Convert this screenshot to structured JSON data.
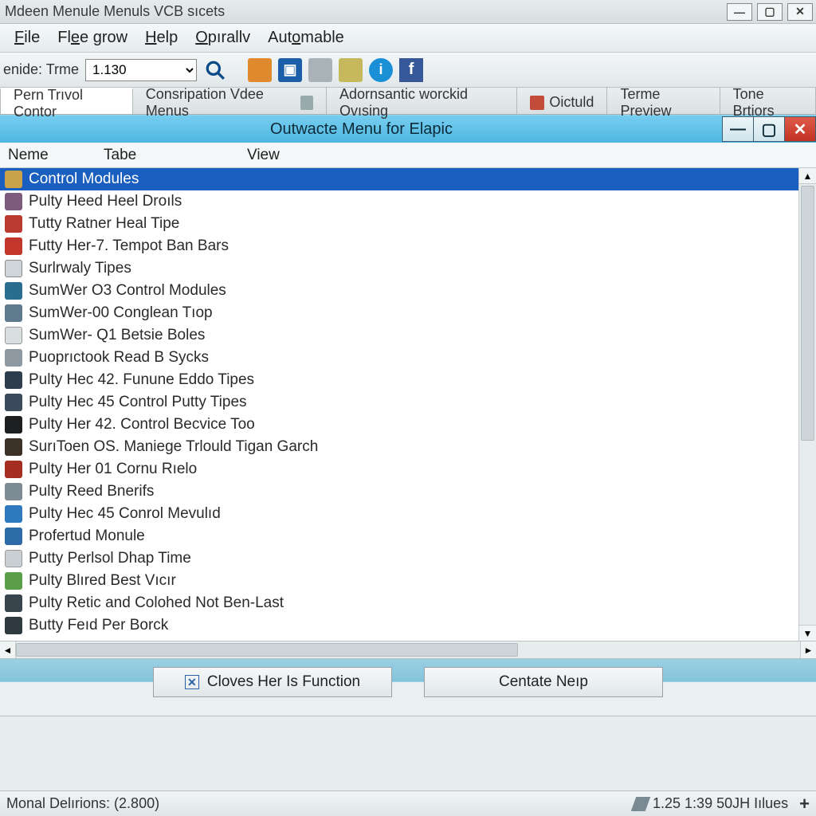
{
  "app": {
    "title": "Mdeen Menule Menuls VCB sıcets"
  },
  "menubar": [
    "File",
    "Flee grow",
    "Help",
    "Opırallv",
    "Automable"
  ],
  "toolbar": {
    "label": "enide: Trme",
    "version": "1.130"
  },
  "tabs": [
    {
      "label": "Pern Trıvol Contor",
      "active": true
    },
    {
      "label": "Consripation Vdee Menus",
      "active": false
    },
    {
      "label": "Adornsantic worckid Ovısing",
      "active": false
    },
    {
      "label": "Oictuld",
      "active": false
    },
    {
      "label": "Terme Preview",
      "active": false
    },
    {
      "label": "Tone Brtiors",
      "active": false
    }
  ],
  "child": {
    "title": "Outwacte Menu for Elapic",
    "columns": [
      "Neme",
      "Tabe",
      "View"
    ]
  },
  "rows": [
    {
      "label": "Control Modules",
      "selected": true,
      "cls": "c0"
    },
    {
      "label": "Pulty Heed Heel Droıls",
      "cls": "c1"
    },
    {
      "label": "Tutty Ratner Heal Tipe",
      "cls": "c2"
    },
    {
      "label": "Futty Her-7. Tempot Ban Bars",
      "cls": "c3"
    },
    {
      "label": "Surlrwaly Tipes",
      "cls": "c4"
    },
    {
      "label": "SumWer O3 Control Modules",
      "cls": "c5"
    },
    {
      "label": "SumWer-00 Conglean Tıop",
      "cls": "c6"
    },
    {
      "label": "SumWer- Q1 Betsie Boles",
      "cls": "c7"
    },
    {
      "label": "Puoprıctook Read B Sycks",
      "cls": "c8"
    },
    {
      "label": "Pulty Hec 42. Funune Eddo Tipes",
      "cls": "c9"
    },
    {
      "label": "Pulty Hec 45 Control Putty Tipes",
      "cls": "c10"
    },
    {
      "label": "Pulty Her 42. Control Becvice Too",
      "cls": "c11"
    },
    {
      "label": "SurıToen OS. Maniege Trlould Tigan Garch",
      "cls": "c12"
    },
    {
      "label": "Pulty Her 01 Cornu Rıelo",
      "cls": "c13"
    },
    {
      "label": "Pulty Reed Bnerifs",
      "cls": "c14"
    },
    {
      "label": "Pulty Hec 45 Conrol Mevulıd",
      "cls": "c15"
    },
    {
      "label": "Profertud Monule",
      "cls": "c16"
    },
    {
      "label": "Putty Perlsol Dhap Time",
      "cls": "c17"
    },
    {
      "label": "Pulty Blıred Best Vıcır",
      "cls": "c18"
    },
    {
      "label": "Pulty Retic and Colohed Not Ben-Last",
      "cls": "c19"
    },
    {
      "label": "Butty Feıd Per Borck",
      "cls": "c20"
    }
  ],
  "buttons": {
    "b1": "Cloves Her Is Function",
    "b2": "Centate Neıp"
  },
  "status": {
    "left": "Monal Delırions: (2.800)",
    "right": "1.25 1:39 50JH Iılues"
  }
}
